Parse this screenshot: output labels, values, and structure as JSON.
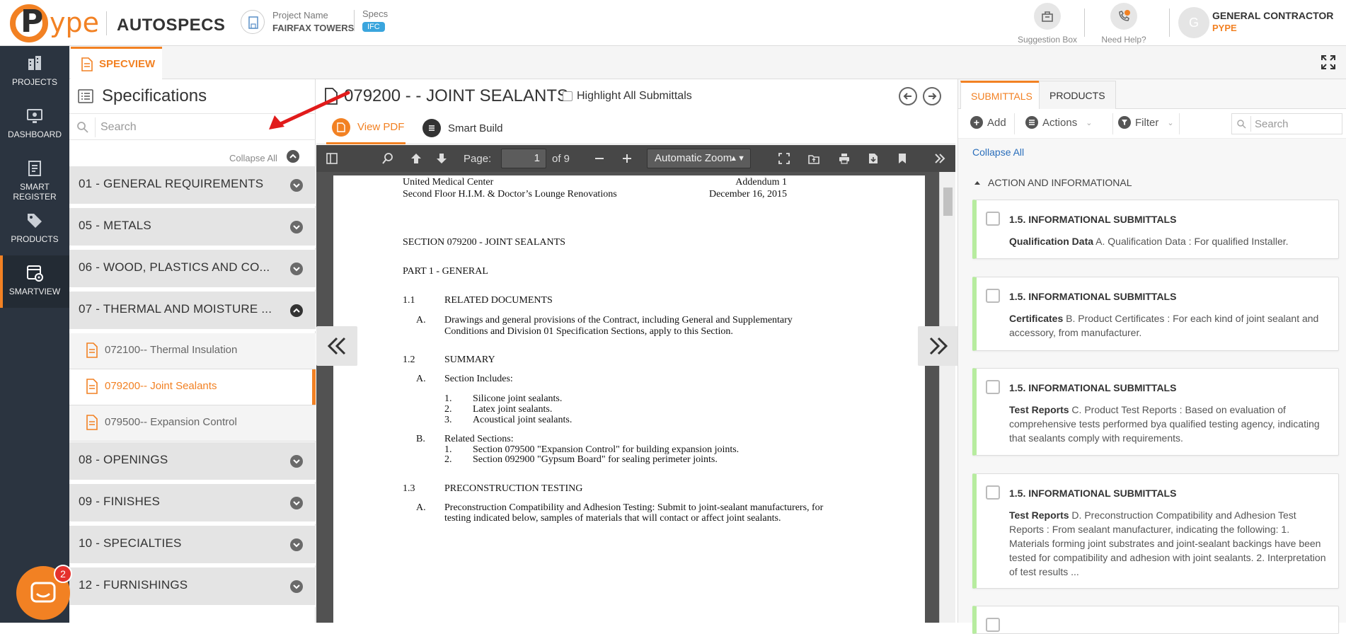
{
  "header": {
    "brand": "AUTOSPECS",
    "project_label": "Project Name",
    "project_name": "FAIRFAX TOWERS",
    "specs_label": "Specs",
    "specs_badge": "IFC",
    "suggestion_label": "Suggestion Box",
    "help_label": "Need Help?",
    "avatar_initial": "G",
    "user_role": "GENERAL CONTRACTOR",
    "user_company": "PYPE"
  },
  "logo": {
    "p": "P",
    "ype": "ype"
  },
  "leftnav": {
    "items": [
      {
        "label": "PROJECTS",
        "icon": "building-icon"
      },
      {
        "label": "DASHBOARD",
        "icon": "monitor-icon"
      },
      {
        "label": "SMART REGISTER",
        "icon": "register-icon"
      },
      {
        "label": "PRODUCTS",
        "icon": "tag-icon"
      },
      {
        "label": "SMARTVIEW",
        "icon": "smartview-icon"
      }
    ],
    "active": "SMARTVIEW"
  },
  "specview_tab": "SPECVIEW",
  "specs": {
    "title": "Specifications",
    "search_placeholder": "Search",
    "collapse_all": "Collapse All",
    "divisions": [
      "01 - GENERAL REQUIREMENTS",
      "05 - METALS",
      "06 - WOOD, PLASTICS AND CO...",
      "07 - THERMAL AND MOISTURE ...",
      "08 - OPENINGS",
      "09 - FINISHES",
      "10 - SPECIALTIES",
      "12 - FURNISHINGS"
    ],
    "sections": [
      "072100-- Thermal Insulation",
      "079200-- Joint Sealants",
      "079500-- Expansion Control"
    ]
  },
  "center": {
    "title": "079200 - - JOINT SEALANTS",
    "highlight_label": "Highlight All Submittals",
    "tab_view_pdf": "View PDF",
    "tab_smart_build": "Smart Build",
    "page_label": "Page:",
    "page_value": "1",
    "page_of": "of 9",
    "zoom": "Automatic Zoom"
  },
  "pdf": {
    "header_left_1": "United Medical Center",
    "header_left_2": "Second Floor H.I.M. & Doctor’s Lounge Renovations",
    "header_right_1": "Addendum 1",
    "header_right_2": "December 16, 2015",
    "section_title": "SECTION 079200 - JOINT SEALANTS",
    "part": "PART 1 - GENERAL",
    "h11_num": "1.1",
    "h11": "RELATED DOCUMENTS",
    "p11_a": "A.",
    "p11_l1": "Drawings and general provisions of the Contract, including General and Supplementary",
    "p11_l2": "Conditions and Division 01 Specification Sections, apply to this Section.",
    "h12_num": "1.2",
    "h12": "SUMMARY",
    "p12_a": "A.",
    "p12_a_text": "Section Includes:",
    "list_a": [
      {
        "n": "1.",
        "t": "Silicone joint sealants."
      },
      {
        "n": "2.",
        "t": "Latex joint sealants."
      },
      {
        "n": "3.",
        "t": "Acoustical joint sealants."
      }
    ],
    "p12_b": "B.",
    "p12_b_text": "Related Sections:",
    "list_b": [
      {
        "n": "1.",
        "t": "Section 079500 \"Expansion Control\" for building expansion joints."
      },
      {
        "n": "2.",
        "t": "Section 092900 \"Gypsum Board\" for sealing perimeter joints."
      }
    ],
    "h13_num": "1.3",
    "h13": "PRECONSTRUCTION TESTING",
    "p13_a": "A.",
    "p13_l1": "Preconstruction Compatibility and Adhesion Testing:  Submit to joint-sealant manufacturers, for",
    "p13_l2": "testing indicated below, samples of materials that will contact or affect joint sealants."
  },
  "right": {
    "tab_submittals": "SUBMITTALS",
    "tab_products": "PRODUCTS",
    "add": "Add",
    "actions": "Actions",
    "filter": "Filter",
    "search_placeholder": "Search",
    "collapse_all": "Collapse All",
    "group": "ACTION AND INFORMATIONAL",
    "cards": [
      {
        "title": "1.5. INFORMATIONAL SUBMITTALS",
        "bold": "Qualification Data",
        "text": " A. Qualification Data : For qualified Installer."
      },
      {
        "title": "1.5. INFORMATIONAL SUBMITTALS",
        "bold": "Certificates",
        "text": " B. Product Certificates : For each kind of joint sealant and accessory, from manufacturer."
      },
      {
        "title": "1.5. INFORMATIONAL SUBMITTALS",
        "bold": "Test Reports",
        "text": " C. Product Test Reports : Based on evaluation of comprehensive tests performed bya qualified testing agency, indicating that sealants comply with requirements."
      },
      {
        "title": "1.5. INFORMATIONAL SUBMITTALS",
        "bold": "Test Reports",
        "text": " D. Preconstruction Compatibility and Adhesion Test Reports : From sealant manufacturer, indicating the following: 1. Materials forming joint substrates and joint-sealant backings have been tested for compatibility and adhesion with joint sealants. 2. Interpretation of test results ..."
      }
    ]
  },
  "chat": {
    "badge": "2"
  },
  "colors": {
    "accent": "#f28123",
    "nav_bg": "#2b3440",
    "card_stripe": "#b7ec9f",
    "link": "#2a6ebb"
  }
}
